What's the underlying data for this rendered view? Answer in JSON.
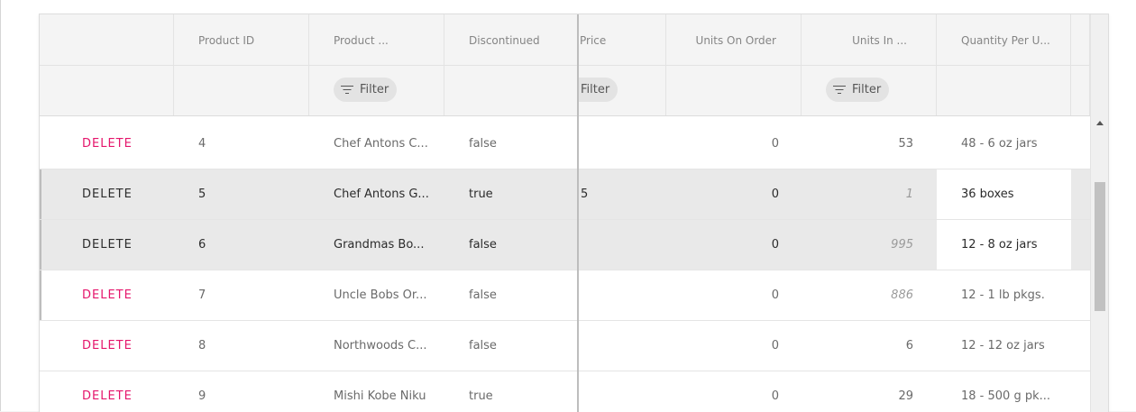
{
  "grid": {
    "columns": [
      {
        "key": "actions",
        "label": ""
      },
      {
        "key": "product_id",
        "label": "Product ID"
      },
      {
        "key": "product_name",
        "label": "Product ..."
      },
      {
        "key": "discontinued",
        "label": "Discontinued"
      },
      {
        "key": "price",
        "label": "Price"
      },
      {
        "key": "units_on_order",
        "label": "Units On Order"
      },
      {
        "key": "units_in_stock",
        "label": "Units In ..."
      },
      {
        "key": "quantity_per_unit",
        "label": "Quantity Per U..."
      }
    ],
    "filter_label": "Filter",
    "delete_label": "DELETE",
    "rows": [
      {
        "product_id": "4",
        "product_name": "Chef Antons C...",
        "discontinued": "false",
        "price": "",
        "units_on_order": "0",
        "units_in_stock": "53",
        "quantity_per_unit": "48 - 6 oz jars",
        "selected": false
      },
      {
        "product_id": "5",
        "product_name": "Chef Antons G...",
        "discontinued": "true",
        "price": "5",
        "units_on_order": "0",
        "units_in_stock": "1",
        "quantity_per_unit": "36 boxes",
        "selected": true
      },
      {
        "product_id": "6",
        "product_name": "Grandmas Bo...",
        "discontinued": "false",
        "price": "",
        "units_on_order": "0",
        "units_in_stock": "995",
        "quantity_per_unit": "12 - 8 oz jars",
        "selected": true
      },
      {
        "product_id": "7",
        "product_name": "Uncle Bobs Or...",
        "discontinued": "false",
        "price": "",
        "units_on_order": "0",
        "units_in_stock": "886",
        "quantity_per_unit": "12 - 1 lb pkgs.",
        "selected": false
      },
      {
        "product_id": "8",
        "product_name": "Northwoods C...",
        "discontinued": "false",
        "price": "",
        "units_on_order": "0",
        "units_in_stock": "6",
        "quantity_per_unit": "12 - 12 oz jars",
        "selected": false
      },
      {
        "product_id": "9",
        "product_name": "Mishi Kobe Niku",
        "discontinued": "true",
        "price": "",
        "units_on_order": "0",
        "units_in_stock": "29",
        "quantity_per_unit": "18 - 500 g pk...",
        "selected": false
      }
    ],
    "italic_stock_rows": [
      1,
      2,
      3
    ]
  },
  "colors": {
    "delete": "#e5156b",
    "header_bg": "#f4f4f4",
    "selected_row_bg": "#e9e9e9"
  }
}
